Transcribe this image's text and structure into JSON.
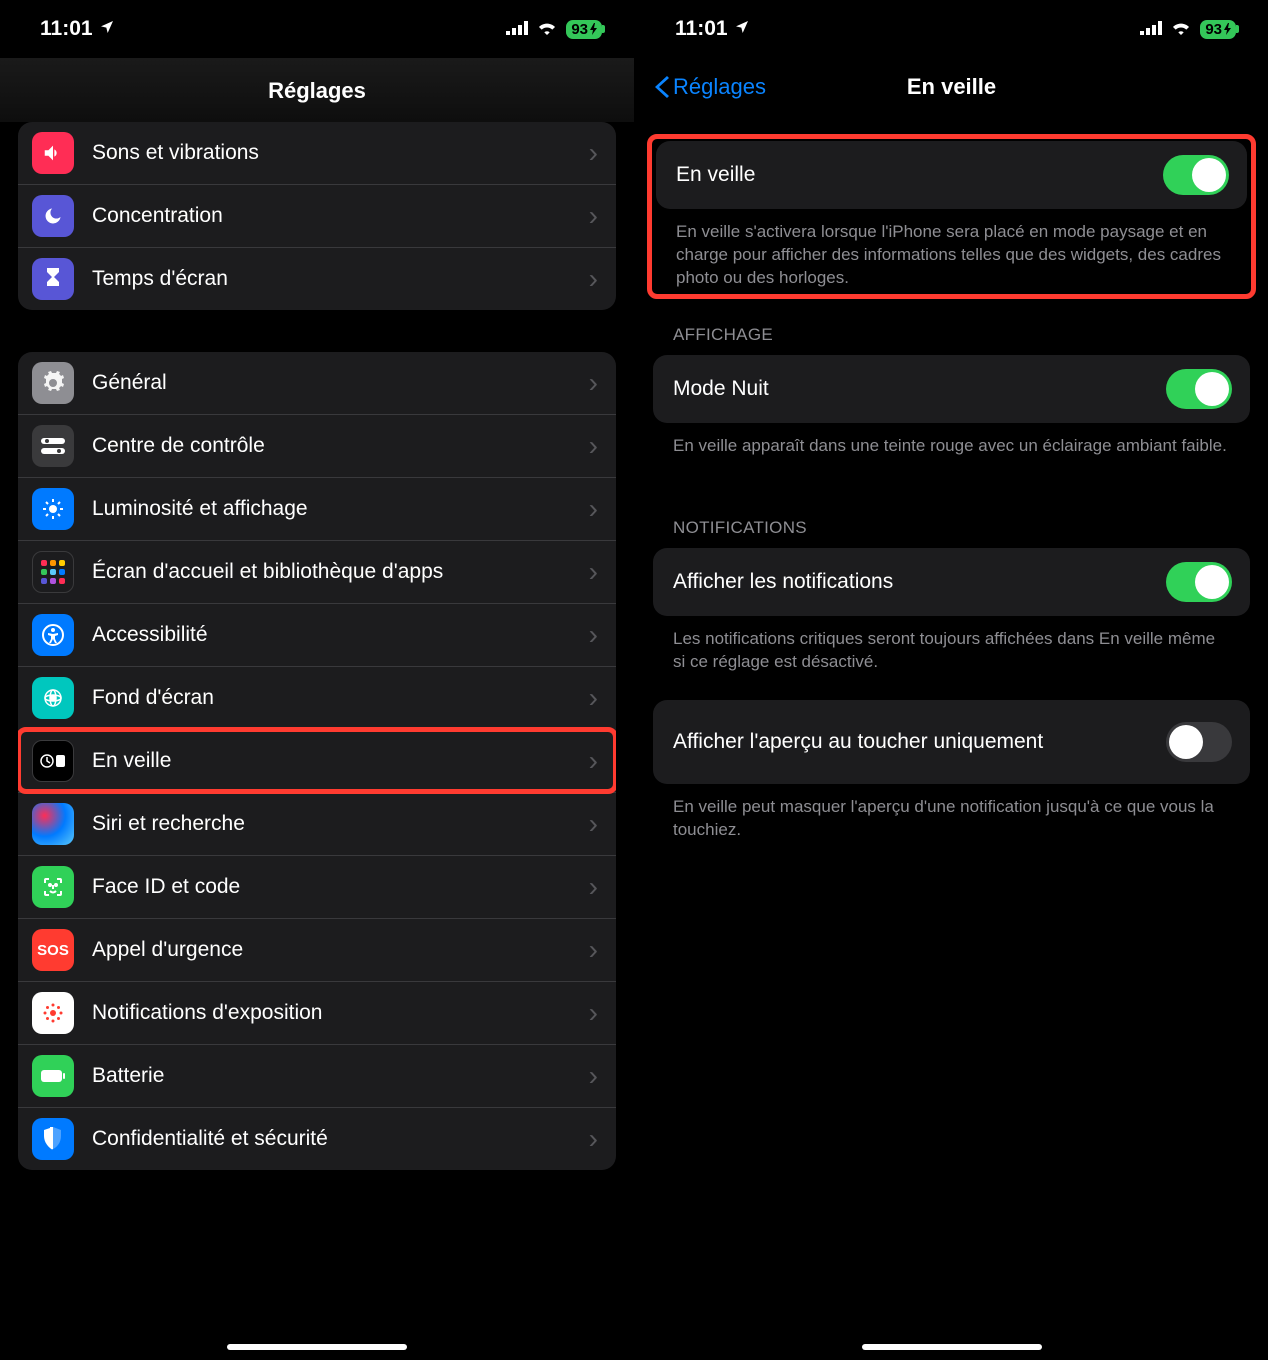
{
  "status": {
    "time": "11:01",
    "battery": "93"
  },
  "screen1": {
    "title": "Réglages",
    "group1": [
      {
        "label": "Sons et vibrations"
      },
      {
        "label": "Concentration"
      },
      {
        "label": "Temps d'écran"
      }
    ],
    "group2": [
      {
        "label": "Général"
      },
      {
        "label": "Centre de contrôle"
      },
      {
        "label": "Luminosité et affichage"
      },
      {
        "label": "Écran d'accueil et bibliothèque d'apps"
      },
      {
        "label": "Accessibilité"
      },
      {
        "label": "Fond d'écran"
      },
      {
        "label": "En veille"
      },
      {
        "label": "Siri et recherche"
      },
      {
        "label": "Face ID et code"
      },
      {
        "label": "Appel d'urgence"
      },
      {
        "label": "Notifications d'exposition"
      },
      {
        "label": "Batterie"
      },
      {
        "label": "Confidentialité et sécurité"
      }
    ]
  },
  "screen2": {
    "back": "Réglages",
    "title": "En veille",
    "standby": {
      "label": "En veille",
      "footer": "En veille s'activera lorsque l'iPhone sera placé en mode paysage et en charge pour afficher des informations telles que des widgets, des cadres photo ou des horloges."
    },
    "display": {
      "header": "AFFICHAGE",
      "night_label": "Mode Nuit",
      "night_footer": "En veille apparaît dans une teinte rouge avec un éclairage ambiant faible."
    },
    "notifications": {
      "header": "NOTIFICATIONS",
      "show_label": "Afficher les notifications",
      "show_footer": "Les notifications critiques seront toujours affichées dans En veille même si ce réglage est désactivé.",
      "preview_label": "Afficher l'aperçu au toucher uniquement",
      "preview_footer": "En veille peut masquer l'aperçu d'une notification jusqu'à ce que vous la touchiez."
    }
  }
}
